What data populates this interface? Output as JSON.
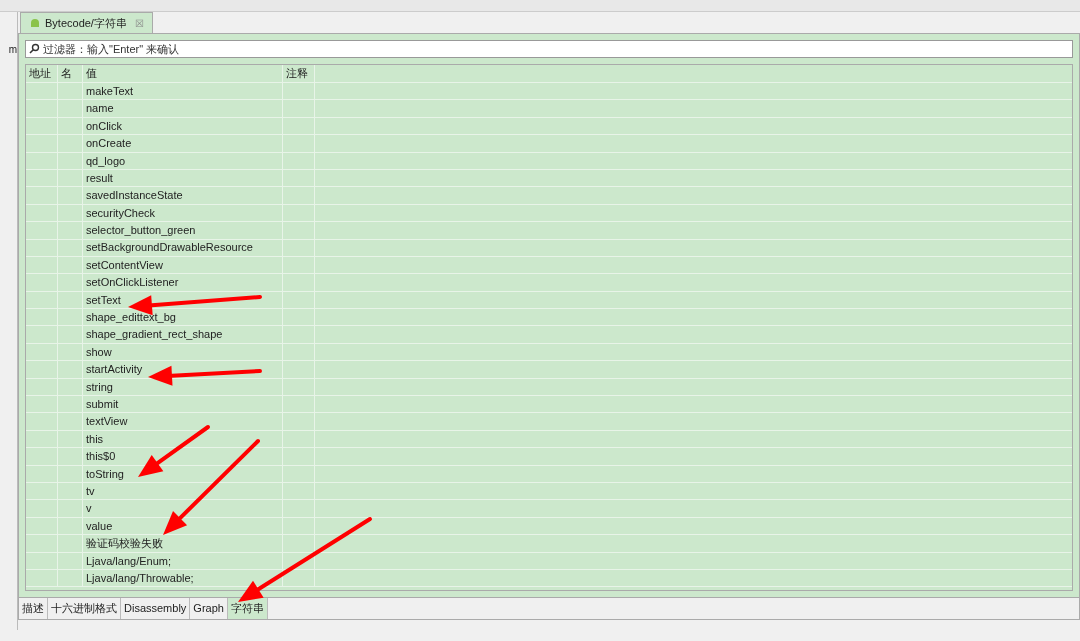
{
  "left_panel": {
    "fragment": "m"
  },
  "editor_tab": {
    "title": "Bytecode/字符串",
    "close": "☒",
    "selected": true
  },
  "filter": {
    "placeholder": "过滤器：输入\"Enter\" 来确认"
  },
  "table": {
    "columns": [
      "地址",
      "名",
      "值",
      "注释"
    ],
    "rows": [
      {
        "value": "makeText"
      },
      {
        "value": "name"
      },
      {
        "value": "onClick"
      },
      {
        "value": "onCreate"
      },
      {
        "value": "qd_logo"
      },
      {
        "value": "result"
      },
      {
        "value": "savedInstanceState"
      },
      {
        "value": "securityCheck"
      },
      {
        "value": "selector_button_green"
      },
      {
        "value": "setBackgroundDrawableResource"
      },
      {
        "value": "setContentView"
      },
      {
        "value": "setOnClickListener"
      },
      {
        "value": "setText"
      },
      {
        "value": "shape_edittext_bg"
      },
      {
        "value": "shape_gradient_rect_shape"
      },
      {
        "value": "show"
      },
      {
        "value": "startActivity"
      },
      {
        "value": "string"
      },
      {
        "value": "submit"
      },
      {
        "value": "textView"
      },
      {
        "value": "this"
      },
      {
        "value": "this$0"
      },
      {
        "value": "toString"
      },
      {
        "value": "tv"
      },
      {
        "value": "v"
      },
      {
        "value": "value"
      },
      {
        "value": "验证码校验失败"
      },
      {
        "value": "Ljava/lang/Enum;"
      },
      {
        "value": "Ljava/lang/Throwable;"
      }
    ]
  },
  "bottom_tabs": [
    {
      "label": "描述",
      "selected": false
    },
    {
      "label": "十六进制格式",
      "selected": false
    },
    {
      "label": "Disassembly",
      "selected": false
    },
    {
      "label": "Graph",
      "selected": false
    },
    {
      "label": "字符串",
      "selected": true
    }
  ]
}
